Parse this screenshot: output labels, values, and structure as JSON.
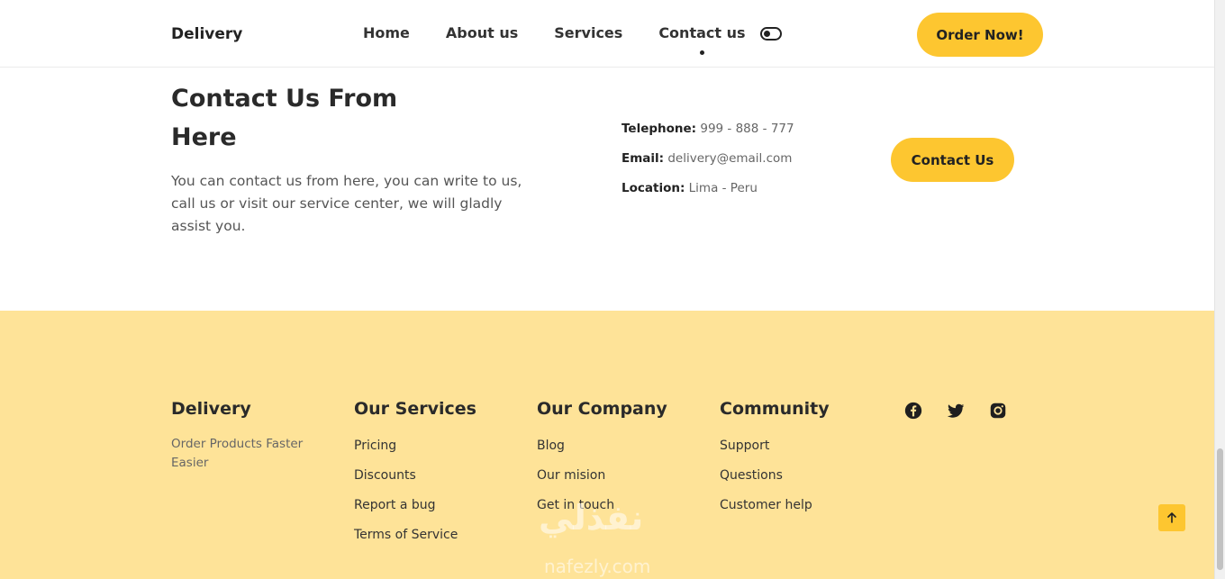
{
  "header": {
    "logo": "Delivery",
    "nav": [
      "Home",
      "About us",
      "Services",
      "Contact us"
    ],
    "active_index": 3,
    "order_button": "Order Now!"
  },
  "contact": {
    "title": "Contact Us From Here",
    "description": "You can contact us from here, you can write to us, call us or visit our service center, we will gladly assist you.",
    "telephone_label": "Telephone:",
    "telephone_value": "999 - 888 - 777",
    "email_label": "Email:",
    "email_value": "delivery@email.com",
    "location_label": "Location:",
    "location_value": "Lima - Peru",
    "button": "Contact Us"
  },
  "footer": {
    "brand": "Delivery",
    "brand_desc": "Order Products Faster Easier",
    "services_title": "Our Services",
    "services": [
      "Pricing",
      "Discounts",
      "Report a bug",
      "Terms of Service"
    ],
    "company_title": "Our Company",
    "company": [
      "Blog",
      "Our mision",
      "Get in touch"
    ],
    "community_title": "Community",
    "community": [
      "Support",
      "Questions",
      "Customer help"
    ],
    "social_icons": [
      "facebook-icon",
      "twitter-icon",
      "instagram-icon"
    ]
  },
  "watermark": {
    "arabic": "نفذلي",
    "latin": "nafezly.com"
  },
  "colors": {
    "accent": "#fdc630",
    "footer_bg": "#fee398"
  }
}
